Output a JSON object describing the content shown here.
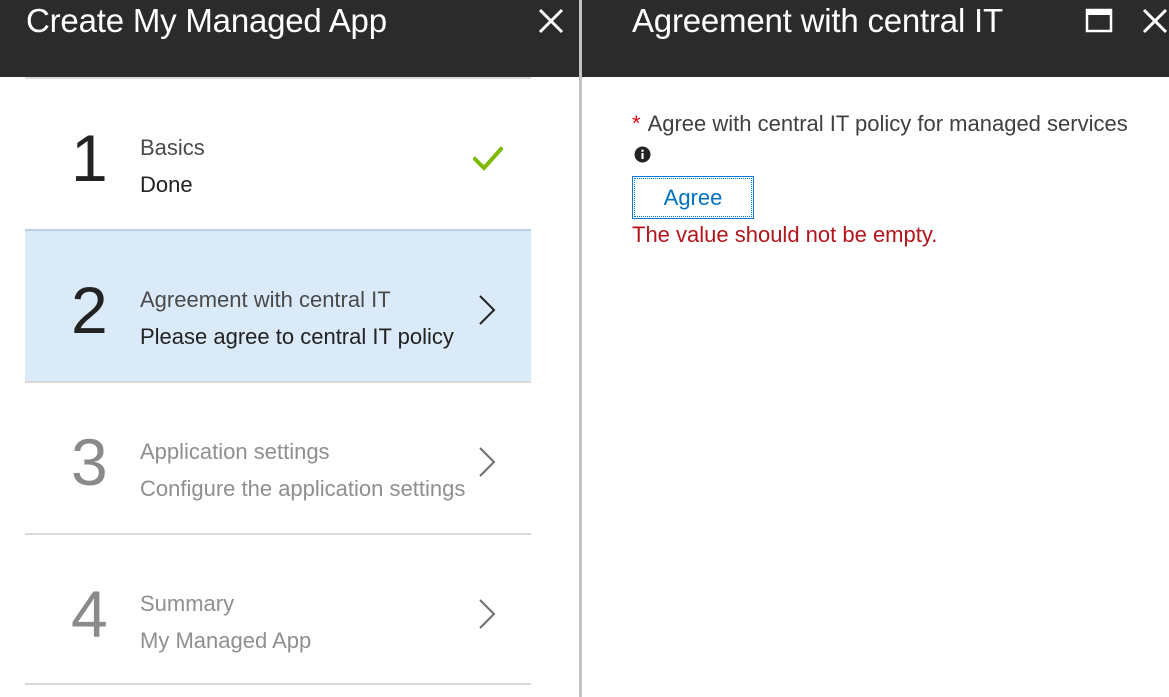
{
  "left_blade": {
    "title": "Create My Managed App",
    "close_icon": "close-icon",
    "steps": [
      {
        "number": "1",
        "title": "Basics",
        "subtitle": "Done",
        "state": "completed",
        "indicator_icon": "checkmark-icon"
      },
      {
        "number": "2",
        "title": "Agreement with central IT",
        "subtitle": "Please agree to central IT policy",
        "state": "active",
        "indicator_icon": "chevron-right-icon"
      },
      {
        "number": "3",
        "title": "Application settings",
        "subtitle": "Configure the application settings",
        "state": "disabled",
        "indicator_icon": "chevron-right-icon"
      },
      {
        "number": "4",
        "title": "Summary",
        "subtitle": "My Managed App",
        "state": "disabled",
        "indicator_icon": "chevron-right-icon"
      }
    ]
  },
  "right_blade": {
    "title": "Agreement with central IT",
    "maximize_icon": "maximize-icon",
    "close_icon": "close-icon",
    "field": {
      "required_mark": "*",
      "label": "Agree with central IT policy for managed services",
      "info_icon": "info-icon",
      "button_label": "Agree",
      "error_message": "The value should not be empty."
    }
  },
  "colors": {
    "header_bg": "#2b2b2b",
    "active_step_bg": "#dbeaf9",
    "accent_blue": "#0078d4",
    "success_green": "#7fba00",
    "required_red": "#e00b1c",
    "error_red": "#b4151b"
  }
}
